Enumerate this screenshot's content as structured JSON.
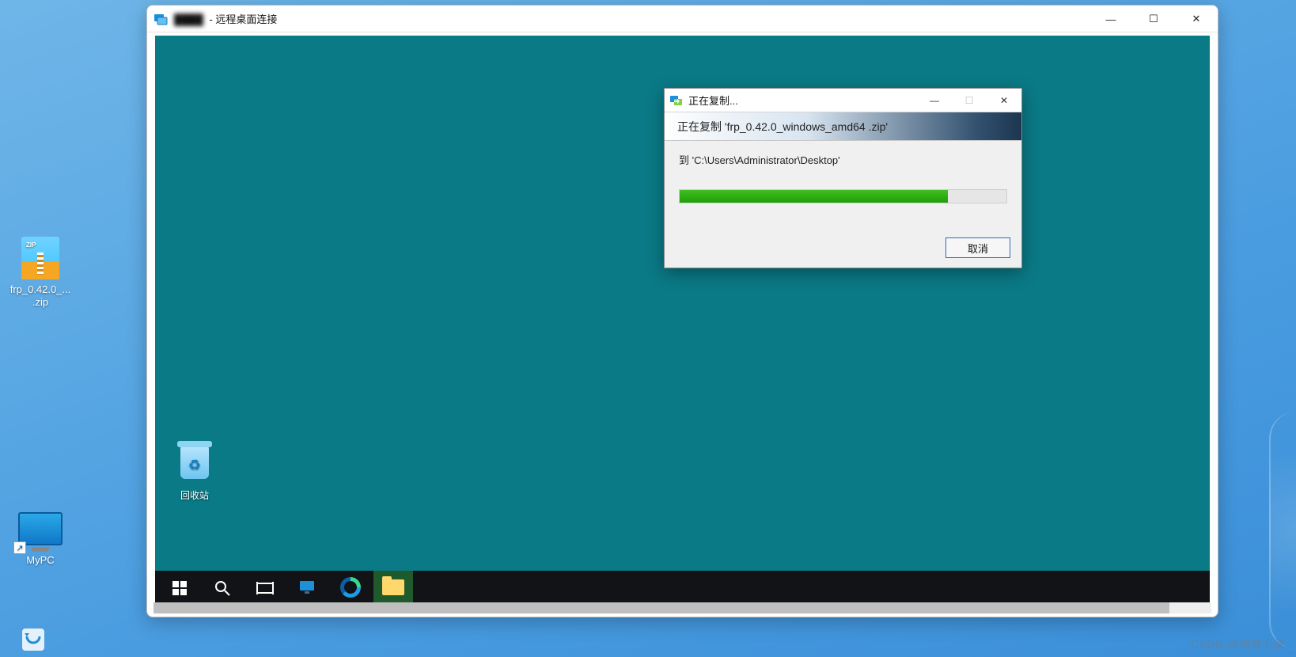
{
  "host": {
    "zip_icon_label": "frp_0.42.0_...\n.zip",
    "mypc_label": "MyPC"
  },
  "rdp_window": {
    "title_blurred": "████",
    "title_suffix": " - 远程桌面连接"
  },
  "remote_desktop": {
    "recycle_bin_label": "回收站"
  },
  "copy_dialog": {
    "title": "正在复制...",
    "banner_prefix": "正在复制 '",
    "banner_filename": "frp_0.42.0_windows_amd64 .zip",
    "banner_suffix": "'",
    "dest_prefix": "到 '",
    "dest_path": "C:\\Users\\Administrator\\Desktop",
    "dest_suffix": "'",
    "progress_percent": 82,
    "cancel_label": "取消"
  },
  "watermark": "CSDN @鸡骨小享",
  "colors": {
    "teal": "#0a7a86",
    "progress_green": "#1f9e07",
    "accent_blue": "#2a6bbf"
  }
}
